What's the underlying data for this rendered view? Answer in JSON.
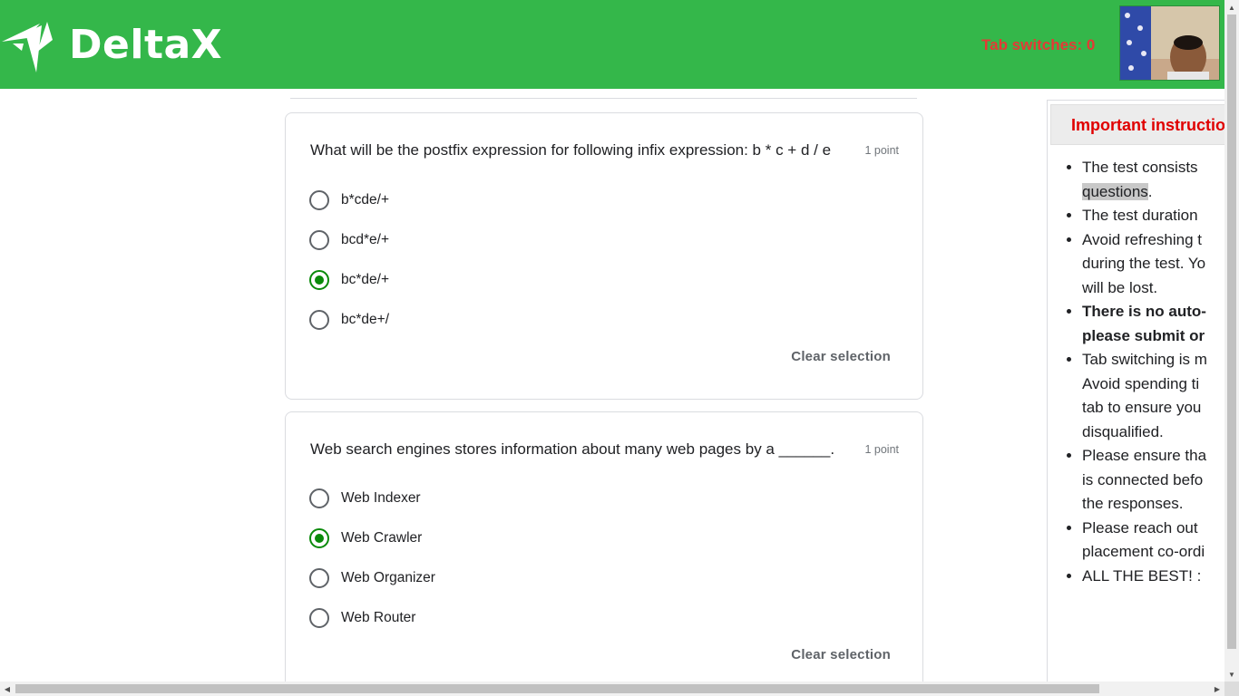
{
  "header": {
    "brand": "DeltaX",
    "tab_switches": "Tab switches: 0"
  },
  "questions": [
    {
      "title": "What will be the postfix expression for following infix expression: b * c + d / e",
      "points": "1 point",
      "options": [
        "b*cde/+",
        "bcd*e/+",
        "bc*de/+",
        "bc*de+/"
      ],
      "selected_index": 2,
      "clear_label": "Clear selection"
    },
    {
      "title": "Web search engines stores information about many web pages by a ______.",
      "points": "1 point",
      "options": [
        "Web Indexer",
        "Web Crawler",
        "Web Organizer",
        "Web Router"
      ],
      "selected_index": 1,
      "clear_label": "Clear selection"
    }
  ],
  "instructions": {
    "title": "Important instructio",
    "items": [
      {
        "line1": "The test consists ",
        "line2_highlight": "questions",
        "line2_rest": "."
      },
      {
        "line1": "The test duration "
      },
      {
        "line1": "Avoid refreshing t",
        "line2": "during the test. Yo",
        "line3": "will be lost."
      },
      {
        "line1": "There is no auto-",
        "line2": "please submit or"
      },
      {
        "line1": "Tab switching is m",
        "line2": "Avoid spending ti",
        "line3": "tab to ensure you",
        "line4": "disqualified."
      },
      {
        "line1": "Please ensure tha",
        "line2": "is connected befo",
        "line3": "the responses."
      },
      {
        "line1": "Please reach out ",
        "line2": "placement co-ordi"
      },
      {
        "line1": "ALL THE BEST! :"
      }
    ]
  },
  "colors": {
    "header_bg": "#34b74a",
    "tab_switch_text": "#e53935",
    "radio_selected": "#0a8a0a",
    "instructions_title": "#e00000"
  }
}
